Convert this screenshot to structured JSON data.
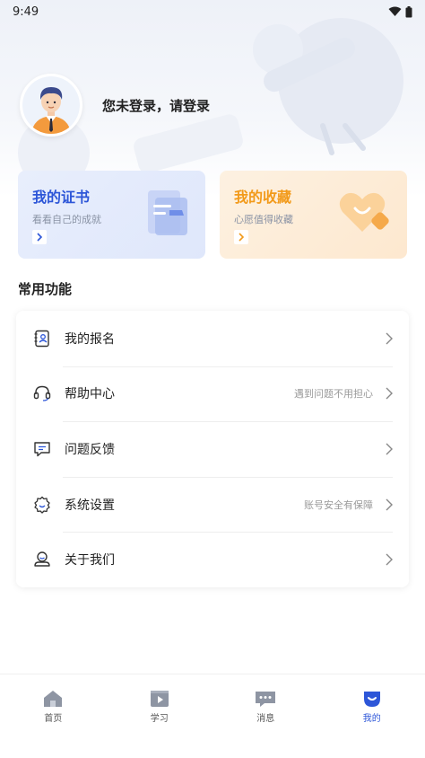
{
  "status_bar": {
    "time": "9:49"
  },
  "profile": {
    "login_prompt": "您未登录，请登录"
  },
  "cards": [
    {
      "title": "我的证书",
      "subtitle": "看看自己的成就"
    },
    {
      "title": "我的收藏",
      "subtitle": "心愿值得收藏"
    }
  ],
  "section": {
    "title": "常用功能"
  },
  "menu": [
    {
      "label": "我的报名",
      "hint": "",
      "icon": "registration-icon"
    },
    {
      "label": "帮助中心",
      "hint": "遇到问题不用担心",
      "icon": "headset-icon"
    },
    {
      "label": "问题反馈",
      "hint": "",
      "icon": "feedback-icon"
    },
    {
      "label": "系统设置",
      "hint": "账号安全有保障",
      "icon": "gear-icon"
    },
    {
      "label": "关于我们",
      "hint": "",
      "icon": "about-icon"
    }
  ],
  "bottom_nav": [
    {
      "label": "首页",
      "icon": "home-icon",
      "active": false
    },
    {
      "label": "学习",
      "icon": "play-icon",
      "active": false
    },
    {
      "label": "消息",
      "icon": "message-icon",
      "active": false
    },
    {
      "label": "我的",
      "icon": "profile-icon",
      "active": true
    }
  ],
  "colors": {
    "accent": "#2d56d8",
    "orange": "#f29a1a"
  }
}
